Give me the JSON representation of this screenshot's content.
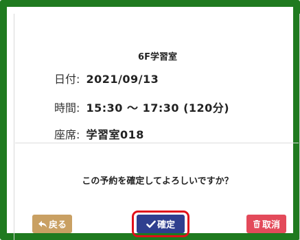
{
  "dialog": {
    "room": "6F学習室",
    "date_label": "日付:",
    "date_value": "2021/09/13",
    "time_label": "時間:",
    "time_value": "15:30 ～ 17:30 (120分)",
    "seat_label": "座席:",
    "seat_value": "学習室018",
    "question": "この予約を確定してよろしいですか？"
  },
  "buttons": {
    "back": {
      "label": "戻る",
      "icon": "reply-arrow-icon",
      "color": "#c9a063"
    },
    "confirm": {
      "label": "確定",
      "icon": "check-icon",
      "color": "#2f3f8f",
      "highlight": "#e0101a"
    },
    "cancel": {
      "label": "取消",
      "icon": "trash-icon",
      "color": "#e34a5a"
    }
  },
  "colors": {
    "frame": "#1f7a1f"
  }
}
